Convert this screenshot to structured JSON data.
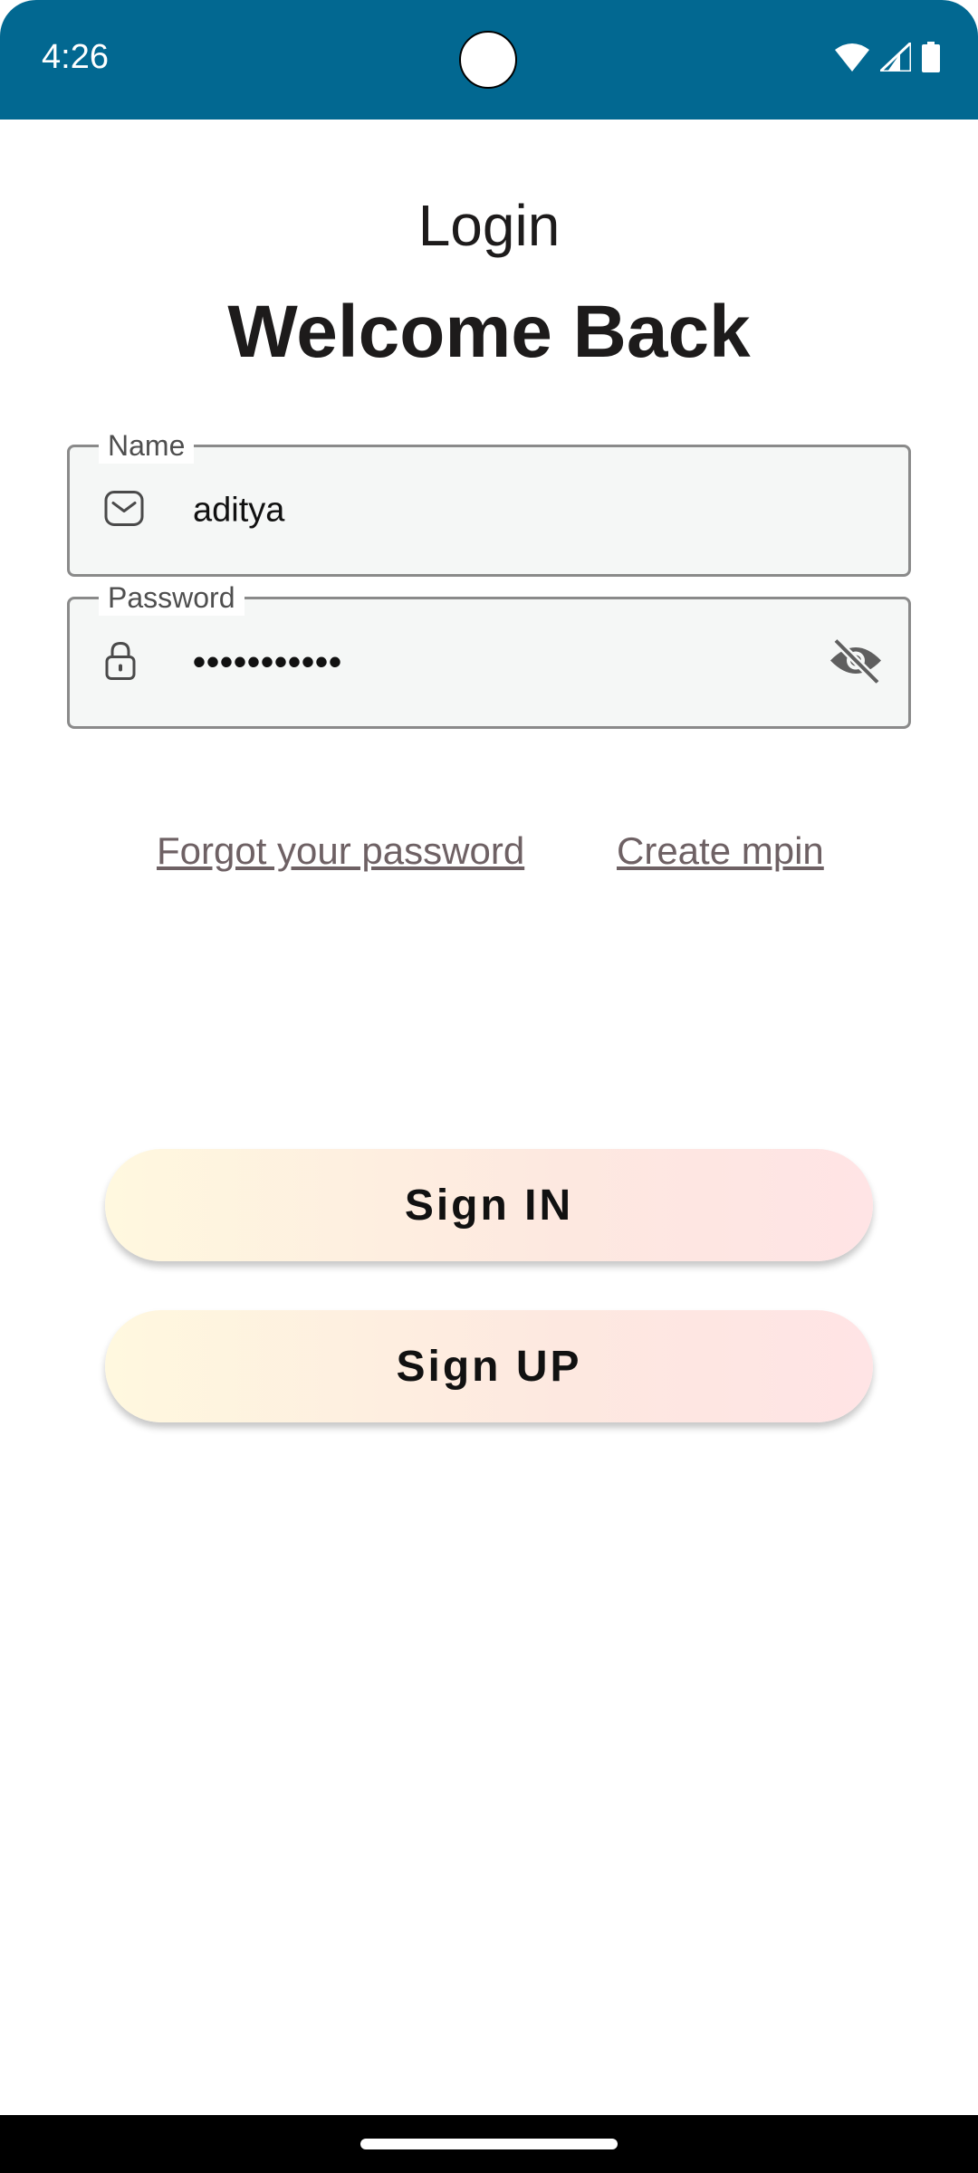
{
  "status_bar": {
    "time": "4:26",
    "icons": [
      "wifi-icon",
      "cellular-signal-icon",
      "battery-icon"
    ],
    "background_color": "#026891"
  },
  "header": {
    "title": "Login",
    "heading": "Welcome Back"
  },
  "form": {
    "name_field": {
      "label": "Name",
      "value": "aditya",
      "icon": "mail-icon"
    },
    "password_field": {
      "label": "Password",
      "value": "•••••••••••",
      "icon": "lock-icon",
      "toggle_icon": "eye-off-icon"
    }
  },
  "links": {
    "forgot_password": "Forgot your password",
    "create_mpin": "Create mpin"
  },
  "buttons": {
    "sign_in": "Sign IN",
    "sign_up": "Sign UP"
  }
}
